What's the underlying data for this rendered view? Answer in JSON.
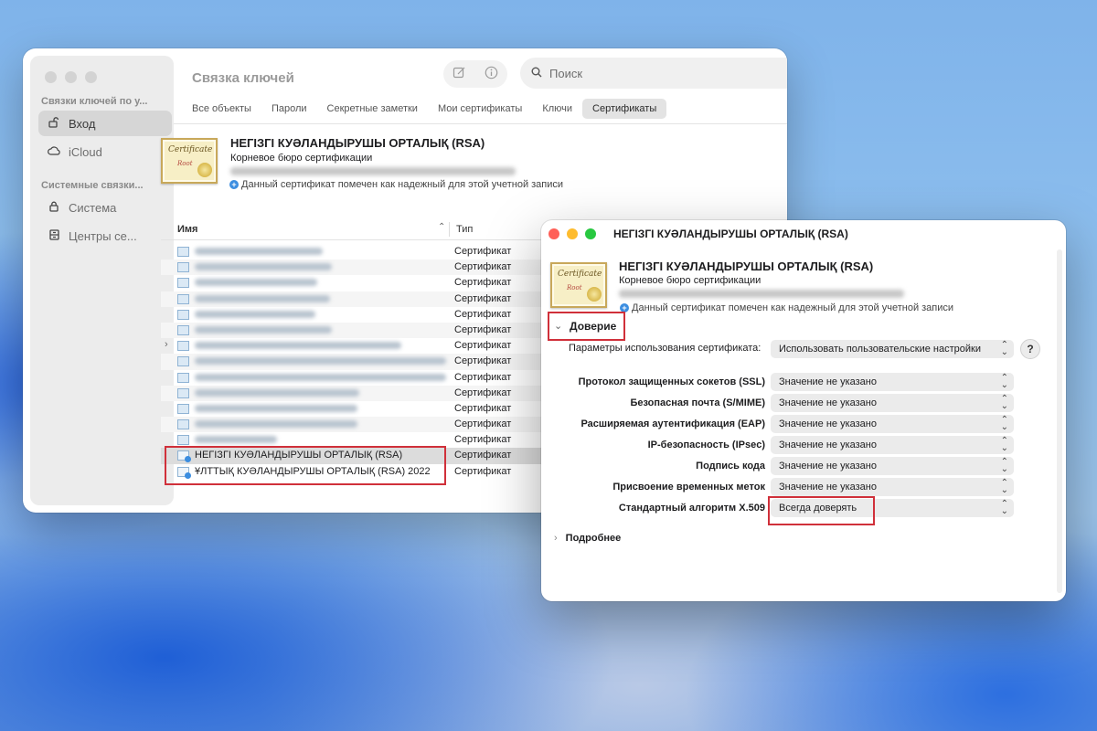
{
  "main_window": {
    "title": "Связка ключей",
    "search_placeholder": "Поиск",
    "sidebar": {
      "section1": "Связки ключей по у...",
      "items1": [
        {
          "label": "Вход",
          "icon": "unlock-icon",
          "active": true
        },
        {
          "label": "iCloud",
          "icon": "cloud-icon",
          "active": false
        }
      ],
      "section2": "Системные связки...",
      "items2": [
        {
          "label": "Система",
          "icon": "lock-icon"
        },
        {
          "label": "Центры се...",
          "icon": "cabinet-icon"
        }
      ]
    },
    "tabs": [
      "Все объекты",
      "Пароли",
      "Секретные заметки",
      "Мои сертификаты",
      "Ключи",
      "Сертификаты"
    ],
    "active_tab": "Сертификаты",
    "cert": {
      "title": "НЕГІЗГІ КУӘЛАНДЫРУШЫ ОРТАЛЫҚ (RSA)",
      "subtitle": "Корневое бюро сертификации",
      "trust_note": "Данный сертификат помечен как надежный для этой учетной записи",
      "badge_title": "Certificate",
      "badge_sub": "Root"
    },
    "columns": {
      "name": "Имя",
      "type": "Тип"
    },
    "rows": [
      {
        "name": "",
        "type": "Сертификат",
        "blurred": true
      },
      {
        "name": "",
        "type": "Сертификат",
        "blurred": true
      },
      {
        "name": "",
        "type": "Сертификат",
        "blurred": true
      },
      {
        "name": "",
        "type": "Сертификат",
        "blurred": true
      },
      {
        "name": "",
        "type": "Сертификат",
        "blurred": true
      },
      {
        "name": "",
        "type": "Сертификат",
        "blurred": true
      },
      {
        "name": "",
        "type": "Сертификат",
        "blurred": true,
        "expandable": true
      },
      {
        "name": "",
        "type": "Сертификат",
        "blurred": true
      },
      {
        "name": "",
        "type": "Сертификат",
        "blurred": true
      },
      {
        "name": "",
        "type": "Сертификат",
        "blurred": true
      },
      {
        "name": "",
        "type": "Сертификат",
        "blurred": true
      },
      {
        "name": "",
        "type": "Сертификат",
        "blurred": true
      },
      {
        "name": "",
        "type": "Сертификат",
        "blurred": true
      },
      {
        "name": "НЕГІЗГІ КУӘЛАНДЫРУШЫ ОРТАЛЫҚ (RSA)",
        "type": "Сертификат",
        "selected": true
      },
      {
        "name": "ҰЛТТЫҚ КУӘЛАНДЫРУШЫ ОРТАЛЫҚ (RSA) 2022",
        "type": "Сертификат"
      }
    ]
  },
  "detail_window": {
    "title": "НЕГІЗГІ КУӘЛАНДЫРУШЫ ОРТАЛЫҚ (RSA)",
    "cert_title": "НЕГІЗГІ КУӘЛАНДЫРУШЫ ОРТАЛЫҚ (RSA)",
    "cert_subtitle": "Корневое бюро сертификации",
    "trust_note": "Данный сертификат помечен как надежный для этой учетной записи",
    "trust_section": "Доверие",
    "usage_label": "Параметры использования сертификата:",
    "usage_value": "Использовать пользовательские настройки",
    "help": "?",
    "settings": [
      {
        "label": "Протокол защищенных сокетов (SSL)",
        "value": "Значение не указано"
      },
      {
        "label": "Безопасная почта (S/MIME)",
        "value": "Значение не указано"
      },
      {
        "label": "Расширяемая аутентификация (EAP)",
        "value": "Значение не указано"
      },
      {
        "label": "IP-безопасность (IPsec)",
        "value": "Значение не указано"
      },
      {
        "label": "Подпись кода",
        "value": "Значение не указано"
      },
      {
        "label": "Присвоение временных меток",
        "value": "Значение не указано"
      },
      {
        "label": "Стандартный алгоритм X.509",
        "value": "Всегда доверять"
      }
    ],
    "more_section": "Подробнее"
  },
  "colors": {
    "highlight": "#d0303a",
    "info": "#3b8de0"
  }
}
